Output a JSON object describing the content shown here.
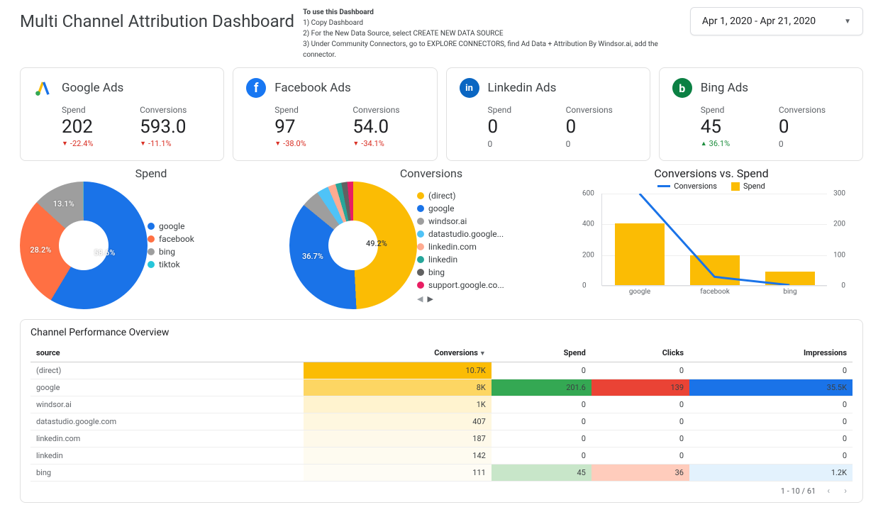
{
  "header": {
    "title": "Multi Channel Attribution Dashboard",
    "instructions_title": "To use this Dashboard",
    "ins1": "1) Copy Dashboard",
    "ins2": "2) For the New Data Source, select CREATE NEW DATA SOURCE",
    "ins3": "3) Under Community Connectors, go to EXPLORE CONNECTORS, find Ad Data + Attribution By Windsor.ai, add the connector.",
    "date_range": "Apr 1, 2020 - Apr 21, 2020"
  },
  "cards": [
    {
      "id": "google-ads",
      "title": "Google Ads",
      "icon_bg": "#fff",
      "spend_label": "Spend",
      "spend": "202",
      "spend_delta": "-22.4%",
      "spend_dir": "down",
      "conv_label": "Conversions",
      "conv": "593.0",
      "conv_delta": "-11.1%",
      "conv_dir": "down"
    },
    {
      "id": "facebook-ads",
      "title": "Facebook Ads",
      "icon_bg": "#1877f2",
      "spend_label": "Spend",
      "spend": "97",
      "spend_delta": "-38.0%",
      "spend_dir": "down",
      "conv_label": "Conversions",
      "conv": "54.0",
      "conv_delta": "-34.1%",
      "conv_dir": "down"
    },
    {
      "id": "linkedin-ads",
      "title": "Linkedin Ads",
      "icon_bg": "#0a66c2",
      "spend_label": "Spend",
      "spend": "0",
      "spend_delta": "0",
      "spend_dir": "none",
      "conv_label": "Conversions",
      "conv": "0",
      "conv_delta": "0",
      "conv_dir": "none"
    },
    {
      "id": "bing-ads",
      "title": "Bing Ads",
      "icon_bg": "#0b8043",
      "spend_label": "Spend",
      "spend": "45",
      "spend_delta": "36.1%",
      "spend_dir": "up",
      "conv_label": "Conversions",
      "conv": "0",
      "conv_delta": "0",
      "conv_dir": "none"
    }
  ],
  "spend_chart": {
    "title": "Spend",
    "slices": [
      {
        "label": "google",
        "pct": 58.6,
        "color": "#1a73e8"
      },
      {
        "label": "facebook",
        "pct": 28.2,
        "color": "#ff7043"
      },
      {
        "label": "bing",
        "pct": 13.1,
        "color": "#9e9e9e"
      },
      {
        "label": "tiktok",
        "pct": 0.1,
        "color": "#26c6da"
      }
    ],
    "visible_labels": {
      "google": "58.6%",
      "facebook": "28.2%",
      "bing": "13.1%"
    }
  },
  "conv_chart": {
    "title": "Conversions",
    "slices": [
      {
        "label": "(direct)",
        "pct": 49.2,
        "color": "#fbbc04"
      },
      {
        "label": "google",
        "pct": 36.7,
        "color": "#1a73e8"
      },
      {
        "label": "windsor.ai",
        "pct": 4.6,
        "color": "#9e9e9e"
      },
      {
        "label": "datastudio.google...",
        "pct": 3.0,
        "color": "#4fc3f7"
      },
      {
        "label": "linkedin.com",
        "pct": 2.0,
        "color": "#ffab91"
      },
      {
        "label": "linkedin",
        "pct": 1.5,
        "color": "#26a69a"
      },
      {
        "label": "bing",
        "pct": 1.5,
        "color": "#616161"
      },
      {
        "label": "support.google.co...",
        "pct": 1.5,
        "color": "#e91e63"
      }
    ],
    "visible_labels": {
      "direct": "49.2%",
      "google": "36.7%"
    }
  },
  "combo_chart": {
    "title": "Conversions vs. Spend",
    "legend_conv": "Conversions",
    "legend_spend": "Spend",
    "y_left": [
      "0",
      "200",
      "400",
      "600"
    ],
    "y_right": [
      "0",
      "100",
      "200",
      "300"
    ],
    "bars": [
      {
        "x": "google",
        "spend": 200,
        "conv": 600
      },
      {
        "x": "facebook",
        "spend": 97,
        "conv": 54
      },
      {
        "x": "bing",
        "spend": 45,
        "conv": 0
      }
    ]
  },
  "table": {
    "title": "Channel Performance Overview",
    "cols": {
      "source": "source",
      "conv": "Conversions",
      "spend": "Spend",
      "clicks": "Clicks",
      "impr": "Impressions"
    },
    "rows": [
      {
        "source": "(direct)",
        "conv": "10.7K",
        "spend": "0",
        "clicks": "0",
        "impr": "0",
        "c_conv": "#fbbc04",
        "c_spend": "",
        "c_clicks": "",
        "c_impr": ""
      },
      {
        "source": "google",
        "conv": "8K",
        "spend": "201.6",
        "clicks": "139",
        "impr": "35.5K",
        "c_conv": "#fdd663",
        "c_spend": "#34a853",
        "c_clicks": "#ea4335",
        "c_impr": "#1a73e8"
      },
      {
        "source": "windsor.ai",
        "conv": "1K",
        "spend": "0",
        "clicks": "0",
        "impr": "0",
        "c_conv": "#fff3cf",
        "c_spend": "",
        "c_clicks": "",
        "c_impr": ""
      },
      {
        "source": "datastudio.google.com",
        "conv": "407",
        "spend": "0",
        "clicks": "0",
        "impr": "0",
        "c_conv": "#fef7e0",
        "c_spend": "",
        "c_clicks": "",
        "c_impr": ""
      },
      {
        "source": "linkedin.com",
        "conv": "187",
        "spend": "0",
        "clicks": "0",
        "impr": "0",
        "c_conv": "#fef9ea",
        "c_spend": "",
        "c_clicks": "",
        "c_impr": ""
      },
      {
        "source": "linkedin",
        "conv": "142",
        "spend": "0",
        "clicks": "0",
        "impr": "0",
        "c_conv": "#fefbf0",
        "c_spend": "",
        "c_clicks": "",
        "c_impr": ""
      },
      {
        "source": "bing",
        "conv": "111",
        "spend": "45",
        "clicks": "36",
        "impr": "1.2K",
        "c_conv": "#fefcf5",
        "c_spend": "#c8e6c9",
        "c_clicks": "#ffccbc",
        "c_impr": "#e3f2fd"
      }
    ],
    "footer": "1 - 10 / 61"
  },
  "chart_data": [
    {
      "type": "pie",
      "title": "Spend",
      "series": [
        {
          "name": "share",
          "values": [
            58.6,
            28.2,
            13.1,
            0.1
          ]
        }
      ],
      "categories": [
        "google",
        "facebook",
        "bing",
        "tiktok"
      ]
    },
    {
      "type": "pie",
      "title": "Conversions",
      "series": [
        {
          "name": "share",
          "values": [
            49.2,
            36.7,
            4.6,
            3.0,
            2.0,
            1.5,
            1.5,
            1.5
          ]
        }
      ],
      "categories": [
        "(direct)",
        "google",
        "windsor.ai",
        "datastudio.google",
        "linkedin.com",
        "linkedin",
        "bing",
        "support.google.com"
      ]
    },
    {
      "type": "bar",
      "title": "Conversions vs. Spend",
      "categories": [
        "google",
        "facebook",
        "bing"
      ],
      "series": [
        {
          "name": "Spend",
          "values": [
            200,
            97,
            45
          ],
          "axis": "right",
          "ylim": [
            0,
            300
          ]
        },
        {
          "name": "Conversions",
          "values": [
            600,
            54,
            0
          ],
          "axis": "left",
          "ylim": [
            0,
            600
          ],
          "kind": "line"
        }
      ],
      "xlabel": "",
      "ylabel": ""
    },
    {
      "type": "table",
      "title": "Channel Performance Overview",
      "columns": [
        "source",
        "Conversions",
        "Spend",
        "Clicks",
        "Impressions"
      ],
      "rows": [
        [
          "(direct)",
          10700,
          0,
          0,
          0
        ],
        [
          "google",
          8000,
          201.6,
          139,
          35500
        ],
        [
          "windsor.ai",
          1000,
          0,
          0,
          0
        ],
        [
          "datastudio.google.com",
          407,
          0,
          0,
          0
        ],
        [
          "linkedin.com",
          187,
          0,
          0,
          0
        ],
        [
          "linkedin",
          142,
          0,
          0,
          0
        ],
        [
          "bing",
          111,
          45,
          36,
          1200
        ]
      ]
    }
  ]
}
